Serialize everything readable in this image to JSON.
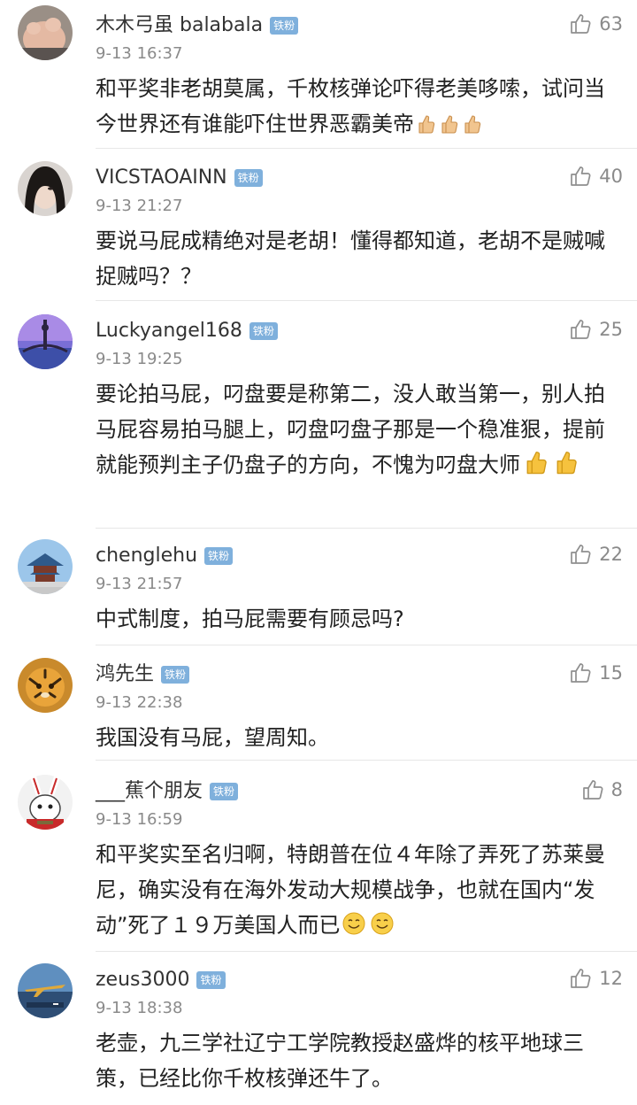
{
  "badge_label": "铁粉",
  "icons": {
    "like": "thumbs-up-outline-icon",
    "emoji_thumb": "thumbs-up-emoji",
    "emoji_smile": "smiling-face-emoji"
  },
  "colors": {
    "badge": "#7fb0dc",
    "text": "#222222",
    "meta": "#8a8a8a",
    "divider": "#e7e7e7"
  },
  "comments": [
    {
      "username": "木木弓虽 balabala",
      "time": "9-13 16:37",
      "likes": "63",
      "text": "和平奖非老胡莫属，千枚核弹论吓得老美哆嗦，试问当今世界还有谁能吓住世界恶霸美帝",
      "trailing_emoji": [
        "thumbs-up",
        "thumbs-up",
        "thumbs-up"
      ]
    },
    {
      "username": "VICSTAOAINN",
      "time": "9-13 21:27",
      "likes": "40",
      "text": "要说马屁成精绝对是老胡！懂得都知道，老胡不是贼喊捉贼吗？？"
    },
    {
      "username": "Luckyangel168",
      "time": "9-13 19:25",
      "likes": "25",
      "text": "要论拍马屁，叼盘要是称第二，没人敢当第一，别人拍马屁容易拍马腿上，叼盘叼盘子那是一个稳准狠，提前就能预判主子仍盘子的方向，不愧为叼盘大师",
      "trailing_emoji": [
        "thumbs-up",
        "thumbs-up"
      ]
    },
    {
      "username": "chenglehu",
      "time": "9-13 21:57",
      "likes": "22",
      "text": "中式制度，拍马屁需要有顾忌吗?"
    },
    {
      "username": "鸿先生",
      "time": "9-13 22:38",
      "likes": "15",
      "text": "我国没有马屁，望周知。"
    },
    {
      "username": "___蕉个朋友",
      "time": "9-13 16:59",
      "likes": "8",
      "text": "和平奖实至名归啊，特朗普在位４年除了弄死了苏莱曼尼，确实没有在海外发动大规模战争，也就在国内“发动”死了１９万美国人而已",
      "trailing_emoji": [
        "smile",
        "smile"
      ]
    },
    {
      "username": "zeus3000",
      "time": "9-13 18:38",
      "likes": "12",
      "text": "老壶，九三学社辽宁工学院教授赵盛烨的核平地球三策，已经比你千枚核弹还牛了。"
    }
  ]
}
